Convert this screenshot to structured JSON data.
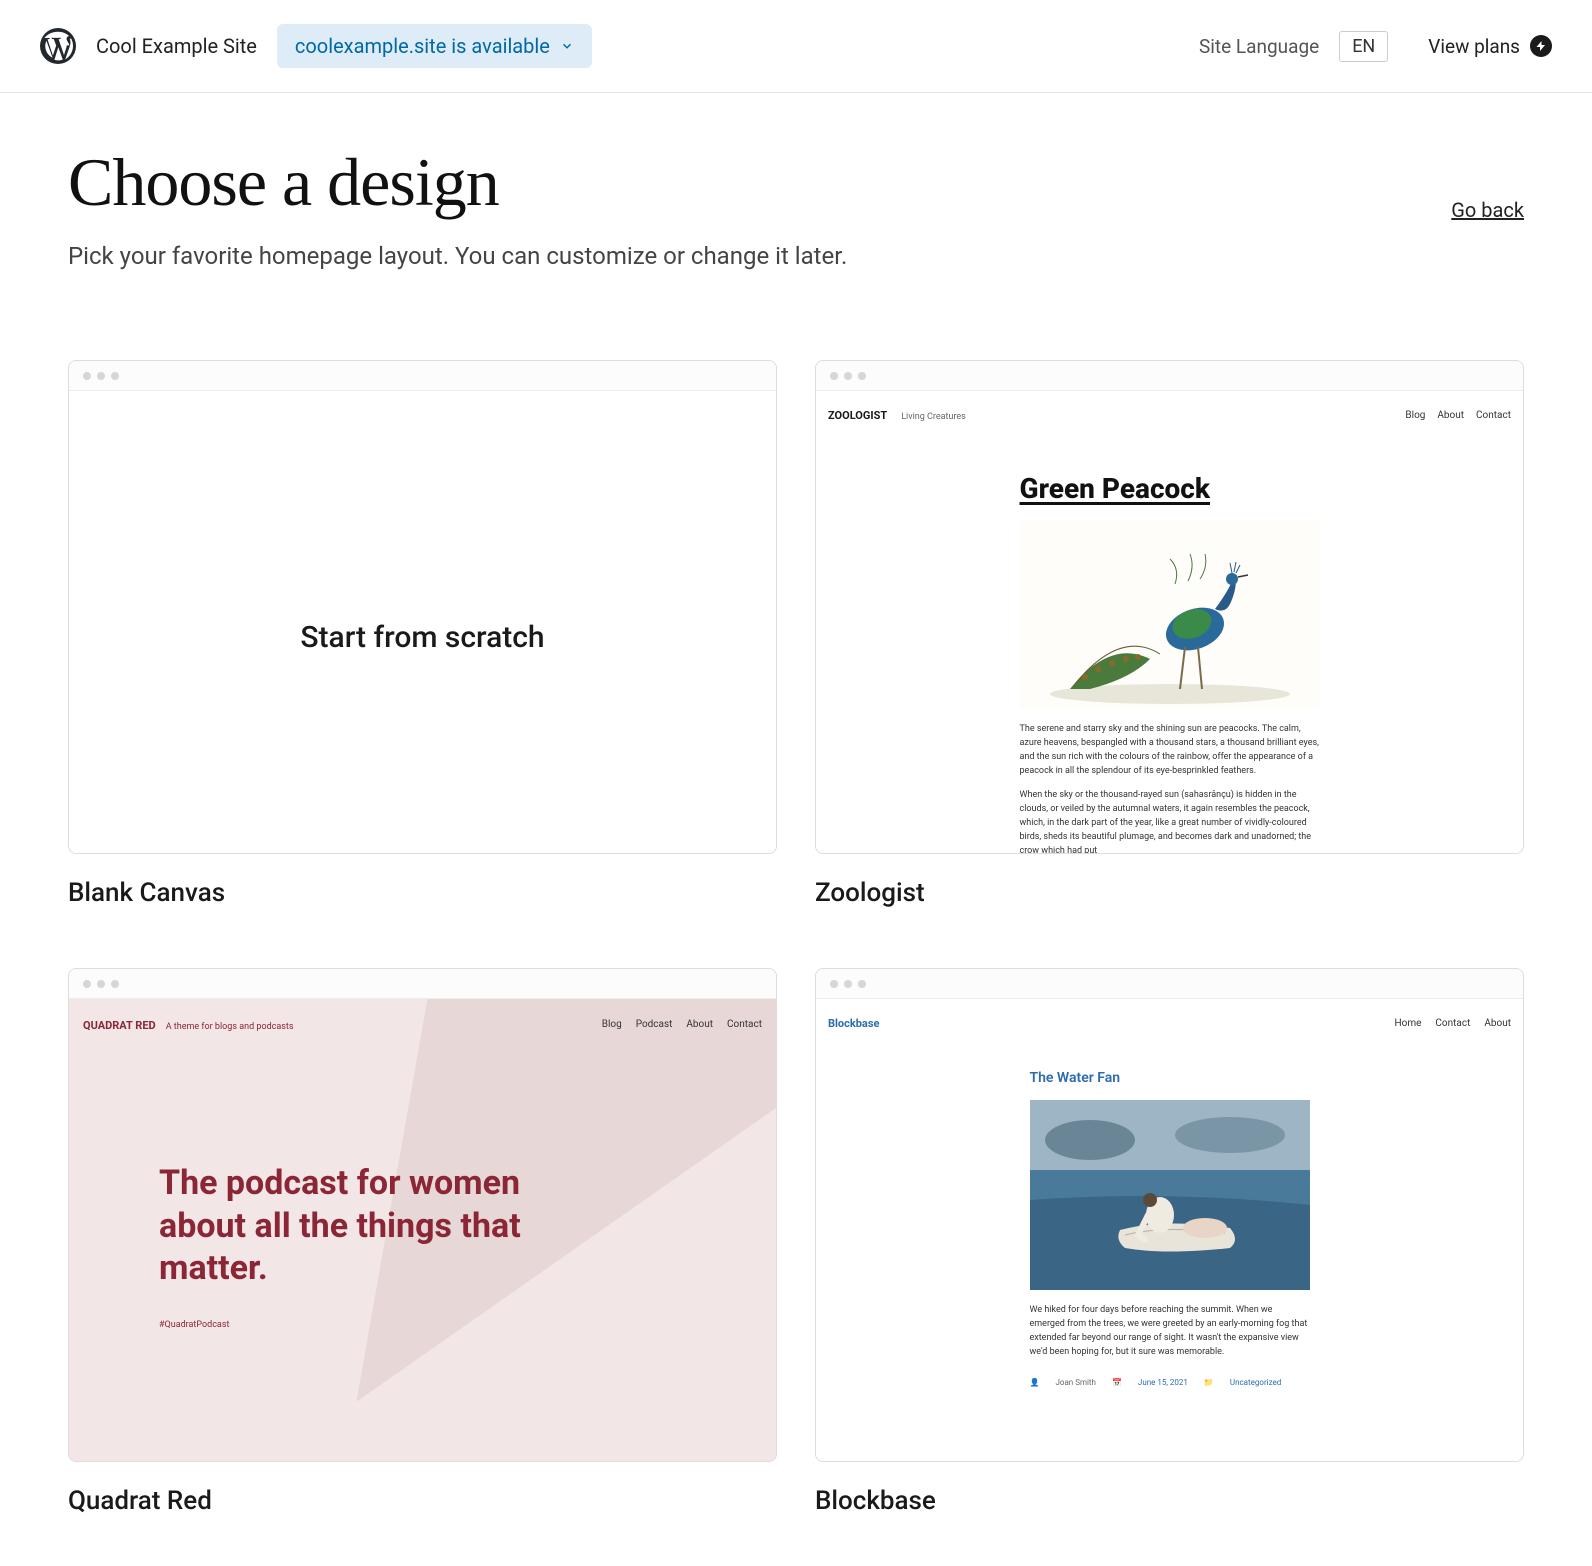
{
  "header": {
    "site_name": "Cool Example Site",
    "domain_status": "coolexample.site is available",
    "language_label": "Site Language",
    "language_value": "EN",
    "view_plans": "View plans"
  },
  "page": {
    "title": "Choose a design",
    "subtitle": "Pick your favorite homepage layout. You can customize or change it later.",
    "go_back": "Go back"
  },
  "themes": [
    {
      "label": "Blank Canvas",
      "preview": {
        "scratch_text": "Start from scratch"
      }
    },
    {
      "label": "Zoologist",
      "preview": {
        "brand": "ZOOLOGIST",
        "tagline": "Living Creatures",
        "nav": [
          "Blog",
          "About",
          "Contact"
        ],
        "post_title": "Green Peacock",
        "para1": "The serene and starry sky and the shining sun are peacocks. The calm, azure heavens, bespangled with a thousand stars, a thousand brilliant eyes, and the sun rich with the colours of the rainbow, offer the appearance of a peacock in all the splendour of its eye-besprinkled feathers.",
        "para2": "When the sky or the thousand-rayed sun (sahasrânçu) is hidden in the clouds, or veiled by the autumnal waters, it again resembles the peacock, which, in the dark part of the year, like a great number of vividly-coloured birds, sheds its beautiful plumage, and becomes dark and unadorned; the crow which had put"
      }
    },
    {
      "label": "Quadrat Red",
      "preview": {
        "brand": "QUADRAT RED",
        "tagline": "A theme for blogs and podcasts",
        "nav": [
          "Blog",
          "Podcast",
          "About",
          "Contact"
        ],
        "hero": "The podcast for women about all the things that matter.",
        "hashtag": "#QuadratPodcast"
      }
    },
    {
      "label": "Blockbase",
      "preview": {
        "brand": "Blockbase",
        "nav": [
          "Home",
          "Contact",
          "About"
        ],
        "post_title": "The Water Fan",
        "para": "We hiked for four days before reaching the summit. When we emerged from the trees, we were greeted by an early-morning fog that extended far beyond our range of sight. It wasn't the expansive view we'd been hoping for, but it sure was memorable.",
        "author": "Joan Smith",
        "date": "June 15, 2021",
        "category": "Uncategorized"
      }
    }
  ]
}
